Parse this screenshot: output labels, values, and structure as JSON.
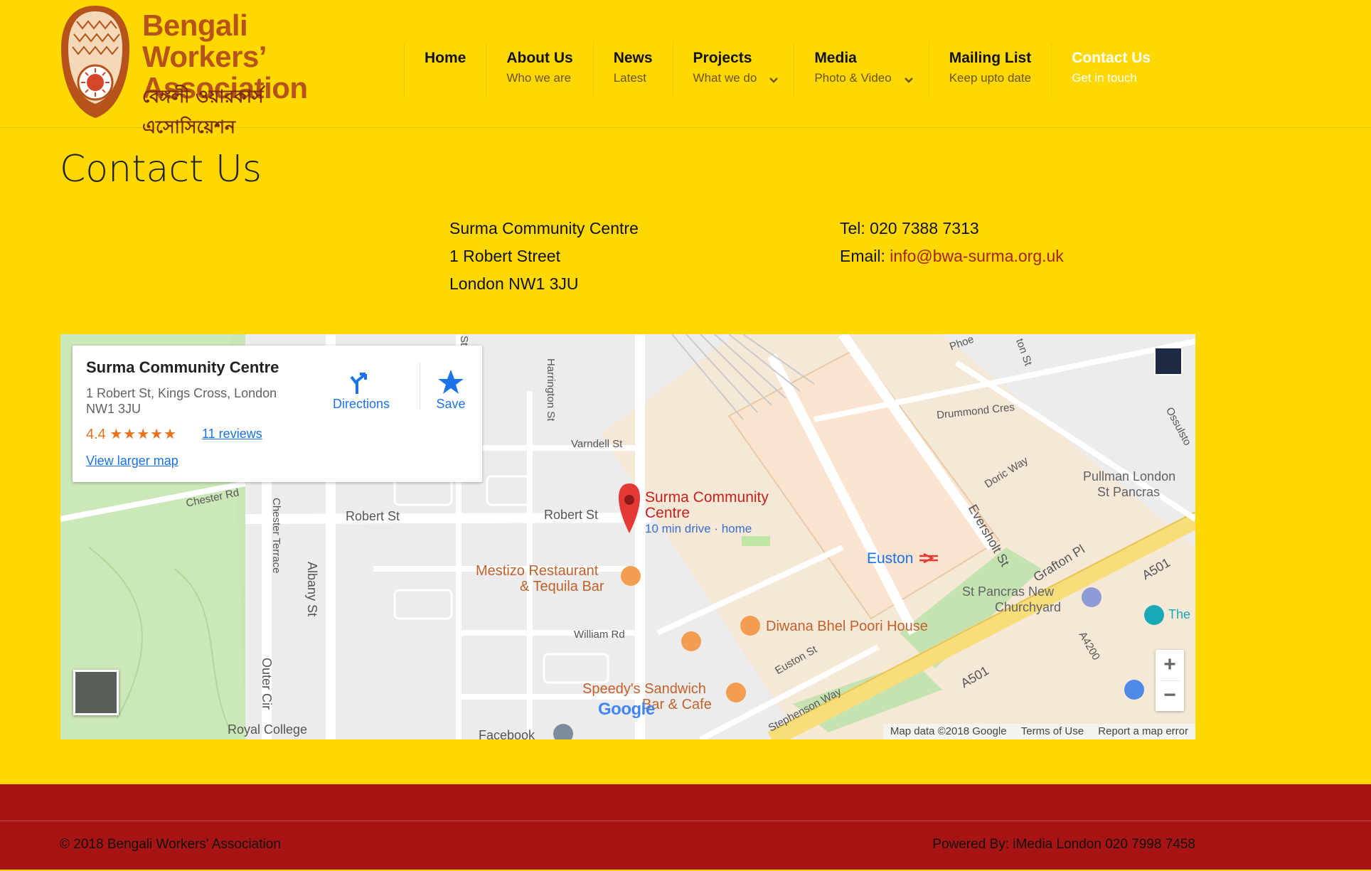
{
  "site": {
    "logo_title_line1": "Bengali Workers’",
    "logo_title_line2": "Association",
    "logo_subtitle": "বেঙ্গলী ওয়ারকার্স এসোসিয়েশন"
  },
  "nav": {
    "items": [
      {
        "label": "Home",
        "sub": ""
      },
      {
        "label": "About Us",
        "sub": "Who we are"
      },
      {
        "label": "News",
        "sub": "Latest"
      },
      {
        "label": "Projects",
        "sub": "What we do"
      },
      {
        "label": "Media",
        "sub": "Photo & Video"
      },
      {
        "label": "Mailing List",
        "sub": "Keep upto date"
      },
      {
        "label": "Contact Us",
        "sub": "Get in touch"
      }
    ],
    "active_color": "#ffffff"
  },
  "page": {
    "title": "Contact Us"
  },
  "address": {
    "line1": "Surma Community Centre",
    "line2": "1 Robert Street",
    "line3": "London NW1 3JU"
  },
  "contact": {
    "tel": "Tel: 020 7388 7313",
    "email_label": "Email: ",
    "email": "info@bwa-surma.org.uk"
  },
  "map": {
    "card": {
      "name": "Surma Community Centre",
      "address": "1 Robert St, Kings Cross, London NW1 3JU",
      "rating": "4.4",
      "stars": "★★★★★",
      "reviews": "11 reviews",
      "larger": "View larger map",
      "directions": "Directions",
      "save": "Save"
    },
    "labels": {
      "robert_st_1": "Robert St",
      "robert_st_2": "Robert St",
      "albany": "Albany St",
      "chester_terrace": "Chester Terrace",
      "chester_rd": "Chester Rd",
      "outer_cir": "Outer Cir",
      "royal_college": "Royal College",
      "facebook": "Facebook",
      "harrington": "Harrington St",
      "varndell": "Varndell St",
      "william": "William Rd",
      "drummond": "Drummond Cres",
      "doric": "Doric Way",
      "eversholt": "Eversholt St",
      "grafton": "Grafton Pl",
      "euston_st": "Euston St",
      "stephenson": "Stephenson Way",
      "a501_1": "A501",
      "a501_2": "A501",
      "a4200": "A4200",
      "phoenix": "Phoe",
      "ossulston": "Ossulsto",
      "pullman_1": "Pullman London",
      "pullman_2": "St Pancras",
      "the": "The",
      "surma_1": "Surma Community",
      "surma_2": "Centre",
      "drive": "10 min drive · home",
      "mestizo_1": "Mestizo Restaurant",
      "mestizo_2": "& Tequila Bar",
      "diwana": "Diwana Bhel Poori House",
      "speedys_1": "Speedy's Sandwich",
      "speedys_2": "Bar & Cafe",
      "euston": "Euston",
      "st_pancras_1": "St Pancras New",
      "st_pancras_2": "Churchyard",
      "google": "Google",
      "tor_st": "ton St",
      "st_top": "St"
    },
    "attribution": {
      "data": "Map data ©2018 Google",
      "terms": "Terms of Use",
      "report": "Report a map error"
    },
    "zoom_in": "+",
    "zoom_out": "−"
  },
  "footer": {
    "copyright": "© 2018 Bengali Workers' Association",
    "powered": "Powered By: iMedia London 020 7998 7458"
  }
}
